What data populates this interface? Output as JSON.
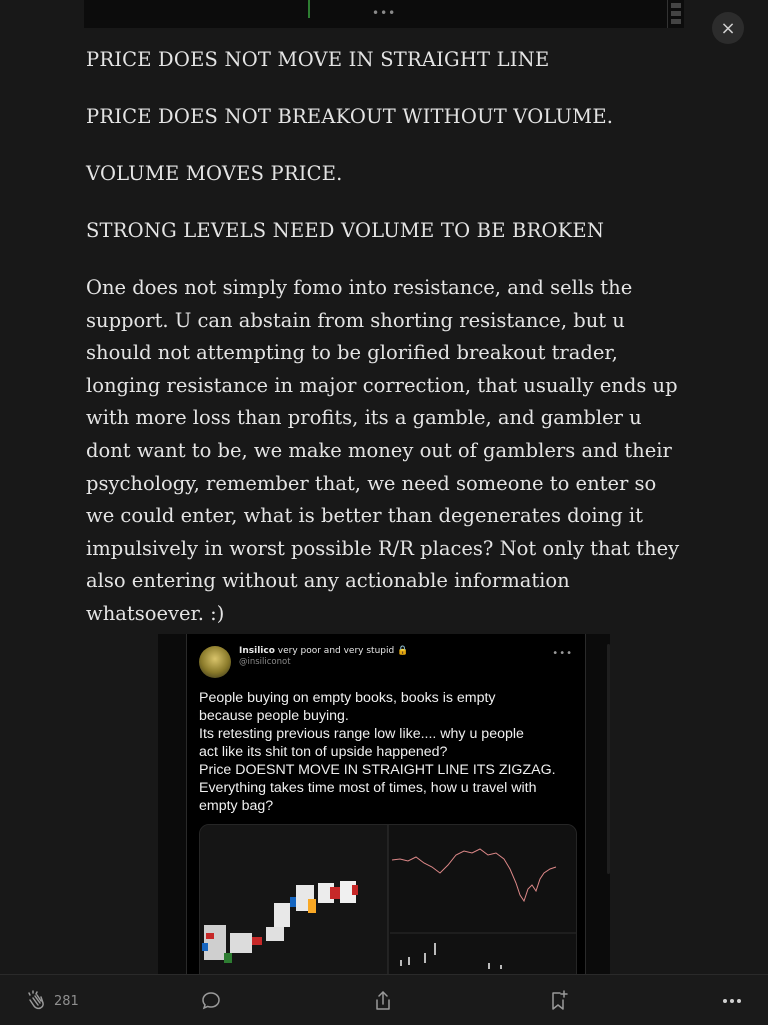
{
  "close": {
    "icon": "close-icon",
    "label": "×"
  },
  "top_strip": {
    "more_icon": "•••"
  },
  "article": {
    "statements": [
      "PRICE DOES NOT MOVE IN STRAIGHT LINE",
      "PRICE DOES NOT BREAKOUT WITHOUT VOLUME.",
      "VOLUME MOVES PRICE.",
      "STRONG LEVELS NEED VOLUME TO BE BROKEN"
    ],
    "paragraph": "One does not simply fomo into resistance, and sells the support. U can abstain from shorting resistance, but u should not attempting to be glorified breakout trader, longing resistance in major correction, that usually ends up with more loss than profits, its a gamble, and gambler u dont want to be, we make money out of gamblers and their psychology, remember that, we need someone to enter so we could enter, what is better than degenerates doing it impulsively in worst possible R/R places? Not only that they also entering without any actionable information whatsoever. :)"
  },
  "embed": {
    "display_name": "Insilico",
    "bio": "very poor and very stupid",
    "handle": "@insiliconot",
    "more": "•••",
    "tweet_lines": [
      "People buying on empty books, books is empty",
      "because people buying.",
      "Its retesting previous range low like.... why u people",
      "act like its shit ton of upside happened?",
      "Price DOESNT MOVE IN STRAIGHT LINE ITS ZIGZAG.",
      "Everything takes time most of times, how u travel with",
      "empty bag?"
    ]
  },
  "toolbar": {
    "clap_count": "281",
    "icons": [
      "clap-icon",
      "comment-icon",
      "share-icon",
      "bookmark-icon",
      "more-icon"
    ]
  },
  "colors": {
    "background": "#181818",
    "text": "#e4e4e4",
    "accent_green": "#2e7d32"
  }
}
